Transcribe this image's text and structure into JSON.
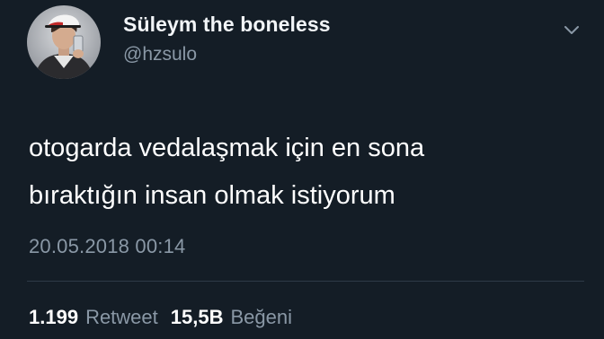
{
  "user": {
    "display_name": "Süleym the boneless",
    "handle": "@hzsulo",
    "avatar_icon": "profile-photo"
  },
  "tweet": {
    "text": "otogarda vedalaşmak için en sona\nbıraktığın insan olmak istiyorum",
    "timestamp": "20.05.2018 00:14"
  },
  "stats": {
    "retweets_count": "1.199",
    "retweets_label": "Retweet",
    "likes_count": "15,5B",
    "likes_label": "Beğeni"
  },
  "menu": {
    "icon": "chevron-down-icon"
  },
  "colors": {
    "background": "#141d26",
    "text_primary": "#ffffff",
    "text_secondary": "#8a98a6",
    "divider": "#2e3a47"
  }
}
